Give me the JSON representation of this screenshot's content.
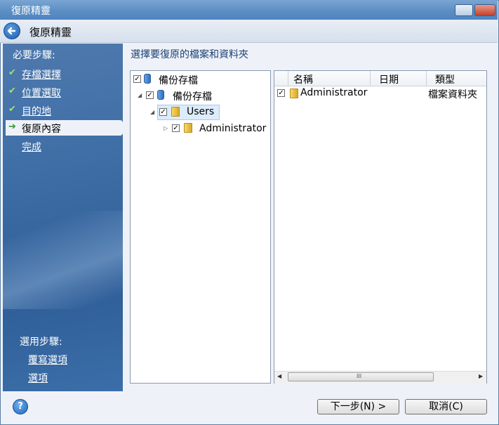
{
  "window": {
    "title": "復原精靈"
  },
  "header": {
    "title": "復原精靈"
  },
  "sidebar": {
    "steps_heading": "必要步驟:",
    "steps": [
      {
        "label": "存檔選擇",
        "state": "done",
        "icon": "checkmark-icon"
      },
      {
        "label": "位置選取",
        "state": "done",
        "icon": "checkmark-icon"
      },
      {
        "label": "目的地",
        "state": "done",
        "icon": "checkmark-icon"
      },
      {
        "label": "復原內容",
        "state": "current",
        "icon": "arrow-right-icon"
      },
      {
        "label": "完成",
        "state": "pending"
      }
    ],
    "optional_heading": "選用步驟:",
    "optional_items": [
      {
        "label": "覆寫選項"
      },
      {
        "label": "選項"
      }
    ]
  },
  "main": {
    "title": "選擇要復原的檔案和資料夾",
    "tree": [
      {
        "label": "備份存檔",
        "checked": true,
        "icon": "archive-icon",
        "level": 0
      },
      {
        "label": "備份存檔",
        "checked": true,
        "icon": "archive-icon",
        "level": 1,
        "expanded": true
      },
      {
        "label": "Users",
        "checked": true,
        "icon": "folder-icon",
        "level": 2,
        "expanded": true,
        "selected": true
      },
      {
        "label": "Administrator",
        "checked": true,
        "icon": "folder-icon",
        "level": 3,
        "expanded": false
      }
    ],
    "list": {
      "columns": [
        "名稱",
        "日期",
        "類型"
      ],
      "rows": [
        {
          "name": "Administrator",
          "date": "",
          "type": "檔案資料夾",
          "checked": true
        }
      ],
      "scroll_grip": "III"
    }
  },
  "footer": {
    "help": "?",
    "next": "下一步(N) >",
    "cancel": "取消(C)"
  },
  "colors": {
    "sidebar": "#3f6ea6",
    "titlebar": "#5c8ec4",
    "title_text": "#1a3e73"
  }
}
